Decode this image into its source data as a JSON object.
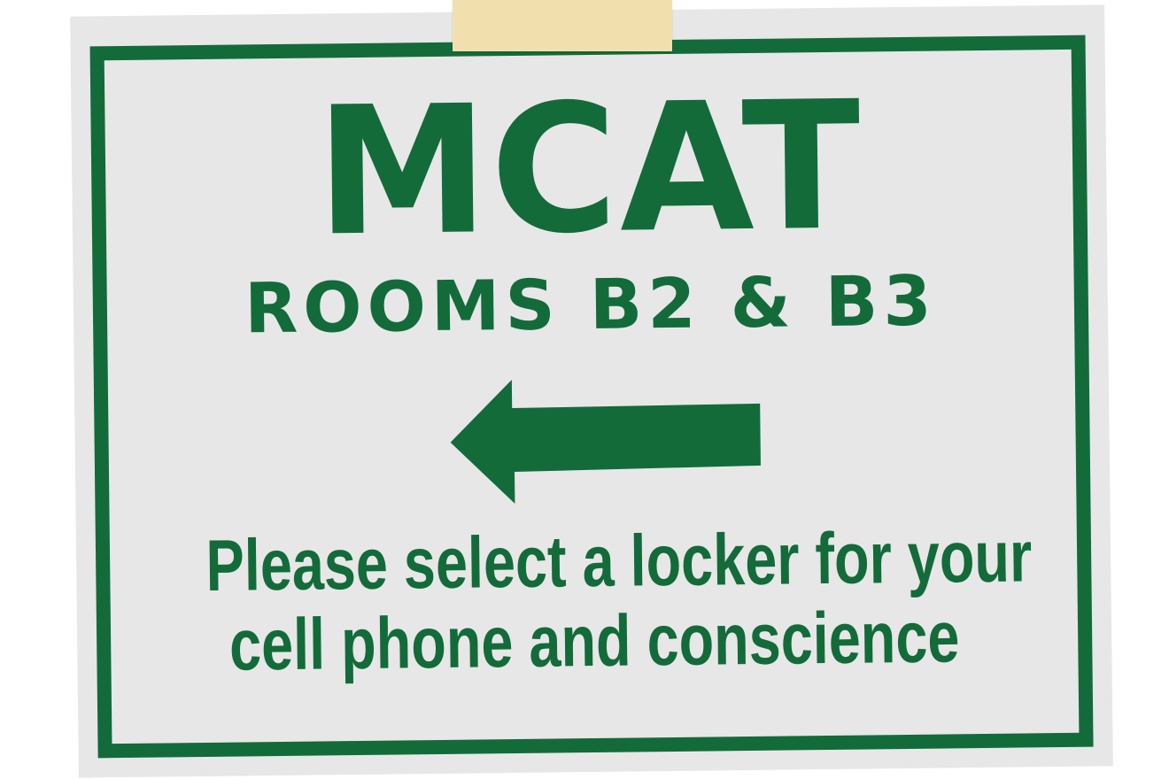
{
  "sign": {
    "title": "MCAT",
    "subtitle": "ROOMS B2 & B3",
    "arrow_direction": "left",
    "message_line1": "Please select a locker for your",
    "message_line2": "cell phone and conscience"
  },
  "colors": {
    "brand_green": "#136b3a",
    "sign_background": "#e7e7e7",
    "tape": "#f1dfae"
  }
}
